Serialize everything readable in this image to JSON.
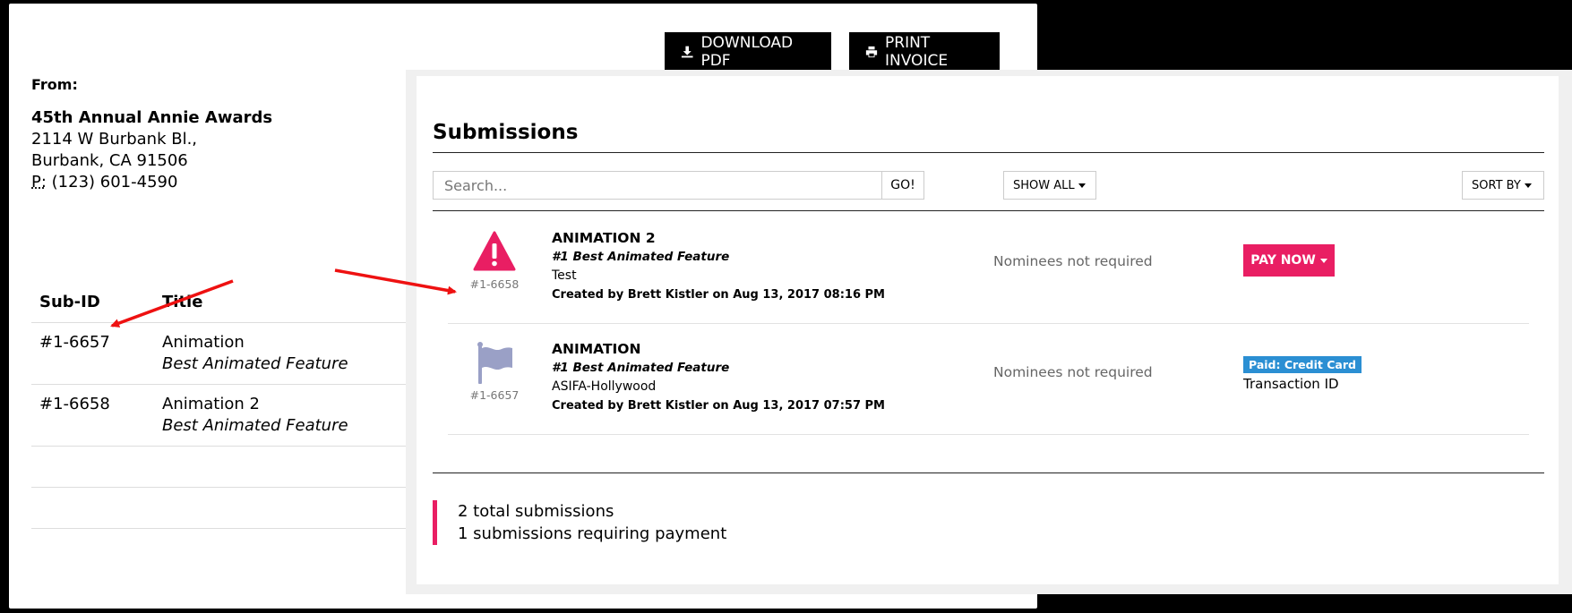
{
  "invoice": {
    "download_label": "DOWNLOAD PDF",
    "print_label": "PRINT INVOICE",
    "from_label": "From:",
    "org_name": "45th Annual Annie Awards",
    "address1": "2114 W Burbank Bl.,",
    "address2": "Burbank, CA 91506",
    "phone_prefix": "P:",
    "phone": "(123) 601-4590",
    "table": {
      "headers": [
        "Sub-ID",
        "Title"
      ],
      "rows": [
        {
          "id": "#1-6657",
          "title": "Animation",
          "category": "Best Animated Feature"
        },
        {
          "id": "#1-6658",
          "title": "Animation 2",
          "category": "Best Animated Feature"
        }
      ]
    }
  },
  "submissions": {
    "title": "Submissions",
    "search_placeholder": "Search...",
    "go_label": "GO!",
    "show_all_label": "SHOW ALL",
    "sort_by_label": "SORT BY",
    "items": [
      {
        "name": "ANIMATION 2",
        "category": "#1 Best Animated Feature",
        "description": "Test",
        "created": "Created by Brett Kistler on Aug 13, 2017 08:16 PM",
        "id": "#1-6658",
        "icon": "warning-icon",
        "nominees": "Nominees not required",
        "action_label": "PAY NOW"
      },
      {
        "name": "ANIMATION",
        "category": "#1 Best Animated Feature",
        "description": "ASIFA-Hollywood",
        "created": "Created by Brett Kistler on Aug 13, 2017 07:57 PM",
        "id": "#1-6657",
        "icon": "flag-icon",
        "nominees": "Nominees not required",
        "badge": "Paid: Credit Card",
        "transaction": "Transaction ID"
      }
    ],
    "summary": {
      "total": "2 total submissions",
      "requiring": "1 submissions requiring payment"
    }
  },
  "colors": {
    "accent": "#e91e63",
    "paid_badge": "#2b8fd3",
    "arrow": "#ee1111",
    "flag_icon": "#9aa0c6"
  }
}
